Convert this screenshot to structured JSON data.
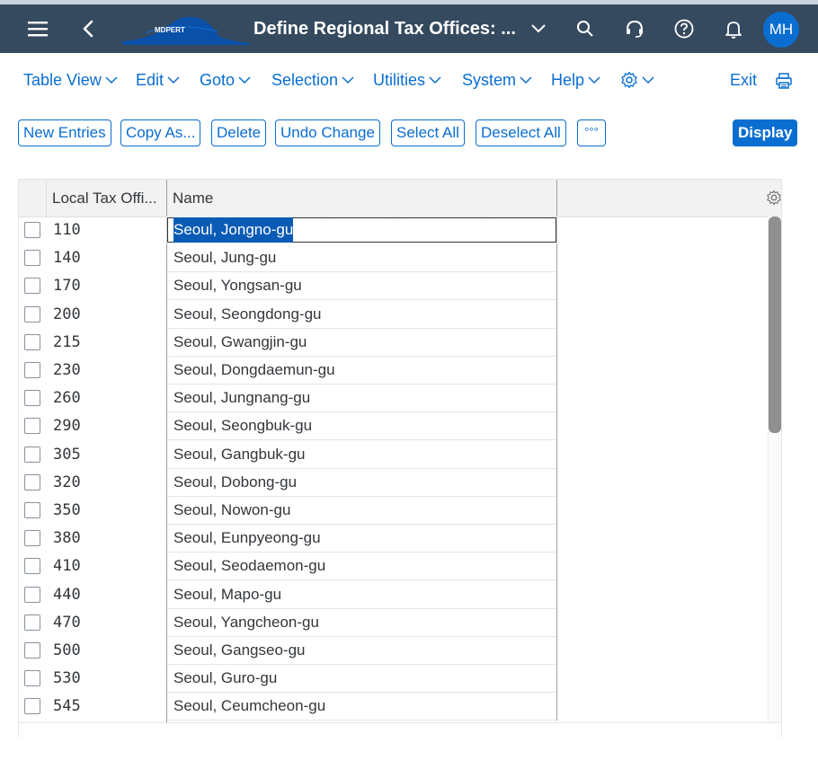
{
  "shell": {
    "logo_text": "MDPERT",
    "title": "Define Regional Tax Offices: ...",
    "avatar": "MH",
    "icons": [
      "hamburger-icon",
      "back-icon",
      "chevron-down-icon",
      "search-icon",
      "headset-icon",
      "help-icon",
      "bell-icon"
    ]
  },
  "menu": {
    "items": [
      "Table View",
      "Edit",
      "Goto",
      "Selection",
      "Utilities",
      "System",
      "Help"
    ],
    "exit": "Exit"
  },
  "toolbar": {
    "buttons": [
      "New Entries",
      "Copy As...",
      "Delete",
      "Undo Change",
      "Select All",
      "Deselect All"
    ],
    "more": "°°°",
    "display": "Display"
  },
  "table": {
    "columns": [
      "Local Tax Offi...",
      "Name"
    ],
    "rows": [
      {
        "code": "110",
        "name": "Seoul, Jongno-gu"
      },
      {
        "code": "140",
        "name": "Seoul, Jung-gu"
      },
      {
        "code": "170",
        "name": "Seoul, Yongsan-gu"
      },
      {
        "code": "200",
        "name": "Seoul, Seongdong-gu"
      },
      {
        "code": "215",
        "name": "Seoul, Gwangjin-gu"
      },
      {
        "code": "230",
        "name": "Seoul, Dongdaemun-gu"
      },
      {
        "code": "260",
        "name": "Seoul, Jungnang-gu"
      },
      {
        "code": "290",
        "name": "Seoul, Seongbuk-gu"
      },
      {
        "code": "305",
        "name": "Seoul, Gangbuk-gu"
      },
      {
        "code": "320",
        "name": "Seoul, Dobong-gu"
      },
      {
        "code": "350",
        "name": "Seoul, Nowon-gu"
      },
      {
        "code": "380",
        "name": "Seoul, Eunpyeong-gu"
      },
      {
        "code": "410",
        "name": "Seoul, Seodaemon-gu"
      },
      {
        "code": "440",
        "name": "Seoul, Mapo-gu"
      },
      {
        "code": "470",
        "name": "Seoul, Yangcheon-gu"
      },
      {
        "code": "500",
        "name": "Seoul, Gangseo-gu"
      },
      {
        "code": "530",
        "name": "Seoul, Guro-gu"
      },
      {
        "code": "545",
        "name": "Seoul, Ceumcheon-gu"
      }
    ]
  },
  "colors": {
    "shell_bg": "#354a5f",
    "accent": "#0a6ed1",
    "selection": "#0a5bb5"
  }
}
